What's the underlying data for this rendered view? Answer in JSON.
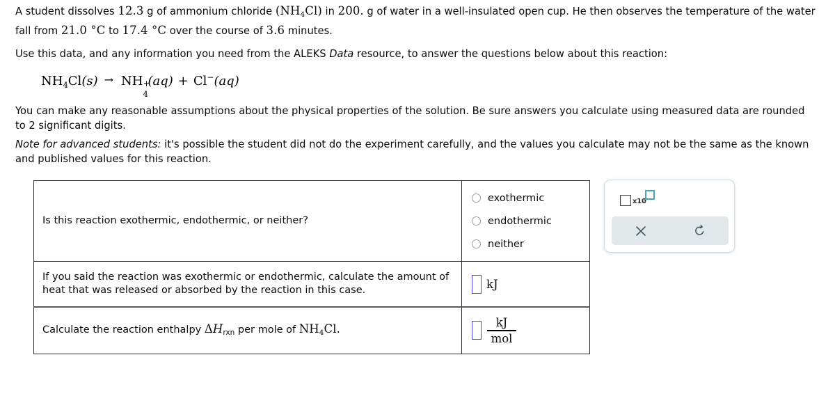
{
  "problem": {
    "intro_before_formula": "A student dissolves ",
    "mass_sample": "12.3",
    "intro_mid1": " g of ammonium chloride ",
    "formula_paren_open": "(",
    "formula_NH": "NH",
    "formula_sub4": "4",
    "formula_Cl": "Cl",
    "formula_paren_close": ")",
    "intro_mid2": " in ",
    "mass_water": "200.",
    "intro_mid3": " g of water in a well-insulated open cup. He then observes the temperature of the water fall from ",
    "temp_initial": "21.0",
    "degC_1": " °C",
    "intro_mid4": " to ",
    "temp_final": "17.4",
    "degC_2": " °C",
    "intro_mid5": " over the course of ",
    "time_minutes": "3.6",
    "intro_end": " minutes.",
    "use_data_before": "Use this data, and any information you need from the ALEKS ",
    "use_data_italic": "Data",
    "use_data_after": " resource, to answer the questions below about this reaction:",
    "assumptions": "You can make any reasonable assumptions about the physical properties of the solution. Be sure answers you calculate using measured data are rounded to 2 significant digits.",
    "note_label": "Note for advanced students:",
    "note_body": " it's possible the student did not do the experiment carefully, and the values you calculate may not be the same as the known and published values for this reaction."
  },
  "equation": {
    "reactant_symbol": "NH",
    "reactant_sub": "4",
    "reactant_element2": "Cl",
    "reactant_state": "(s)",
    "arrow": "→",
    "product1_symbol": "NH",
    "product1_sub": "4",
    "product1_charge": "+",
    "product1_state": "(aq)",
    "plus": "+",
    "product2_symbol": "Cl",
    "product2_charge": "−",
    "product2_state": "(aq)"
  },
  "table": {
    "rows": [
      {
        "question": "Is this reaction exothermic, endothermic, or neither?",
        "answer_type": "radio",
        "options": [
          "exothermic",
          "endothermic",
          "neither"
        ]
      },
      {
        "question": "If you said the reaction was exothermic or endothermic, calculate the amount of heat that was released or absorbed by the reaction in this case.",
        "answer_type": "input-unit",
        "input_value": "",
        "unit": "kJ"
      },
      {
        "question_part1": "Calculate the reaction enthalpy ",
        "question_delta": "Δ",
        "question_H": "H",
        "question_sub": "rxn",
        "question_part2": " per mole of ",
        "question_formula_NH": "NH",
        "question_formula_sub": "4",
        "question_formula_Cl": "Cl.",
        "answer_type": "input-fraction",
        "input_value": "",
        "unit_numerator": "kJ",
        "unit_denominator": "mol"
      }
    ]
  },
  "toolbar": {
    "scientific_notation_base": "",
    "scientific_notation_label": "x10",
    "scientific_notation_exponent": "",
    "clear_label": "×",
    "undo_label": "↺"
  },
  "colors": {
    "input_border": "#4343e8",
    "toolbar_accent": "#4aa3b8",
    "toolbar_button_bg": "#e2e8ea",
    "table_border": "#2b2b2b"
  }
}
